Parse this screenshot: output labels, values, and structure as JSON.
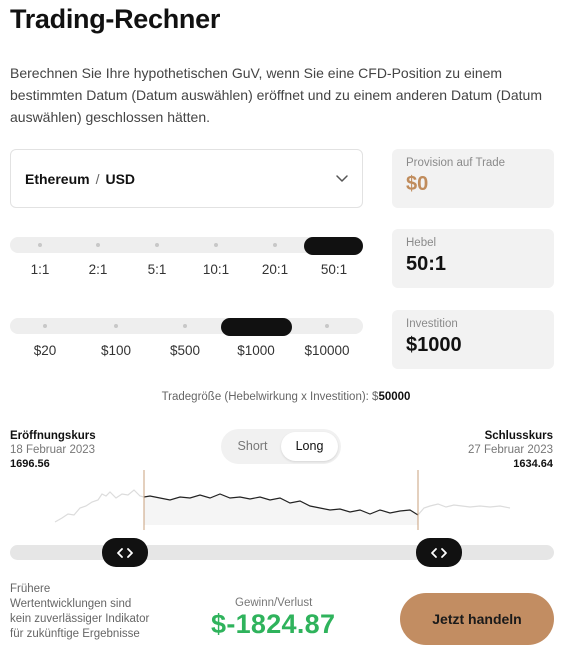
{
  "header": {
    "title": "Trading-Rechner",
    "intro": "Berechnen Sie Ihre hypothetischen GuV, wenn Sie eine CFD-Position zu einem bestimmten Datum (Datum auswählen) eröffnet und zu einem anderen Datum (Datum auswählen) geschlossen hätten."
  },
  "pair": {
    "base": "Ethereum",
    "separator": "/",
    "quote": "USD",
    "icon": "chevron-down-icon"
  },
  "commission": {
    "label": "Provision auf Trade",
    "value": "$0",
    "color": "#c08c5c"
  },
  "leverage": {
    "label": "Hebel",
    "value": "50:1",
    "options": [
      "1:1",
      "2:1",
      "5:1",
      "10:1",
      "20:1",
      "50:1"
    ],
    "selected_index": 5
  },
  "investment": {
    "label": "Investition",
    "value": "$1000",
    "options": [
      "$20",
      "$100",
      "$500",
      "$1000",
      "$10000"
    ],
    "selected_index": 3
  },
  "tradesize": {
    "label": "Tradegröße (Hebelwirkung x Investition): $",
    "value": "50000"
  },
  "open": {
    "title": "Eröffnungskurs",
    "date": "18 Februar 2023",
    "price": "1696.56"
  },
  "close": {
    "title": "Schlusskurs",
    "date": "27 Februar 2023",
    "price": "1634.64"
  },
  "direction": {
    "short": "Short",
    "long": "Long",
    "selected": "Long"
  },
  "range": {
    "start_fraction": 0.17,
    "end_fraction": 0.75,
    "handle_glyph": "‹ ›",
    "icon": "drag-arrows-icon"
  },
  "disclaimer": "Frühere Wertentwicklungen sind kein zuverlässiger Indikator für zukünftige Ergebnisse",
  "result": {
    "label": "Gewinn/Verlust",
    "value": "$-1824.87",
    "color": "#2fb35c"
  },
  "cta": {
    "label": "Jetzt handeln",
    "color": "#c28d62"
  }
}
